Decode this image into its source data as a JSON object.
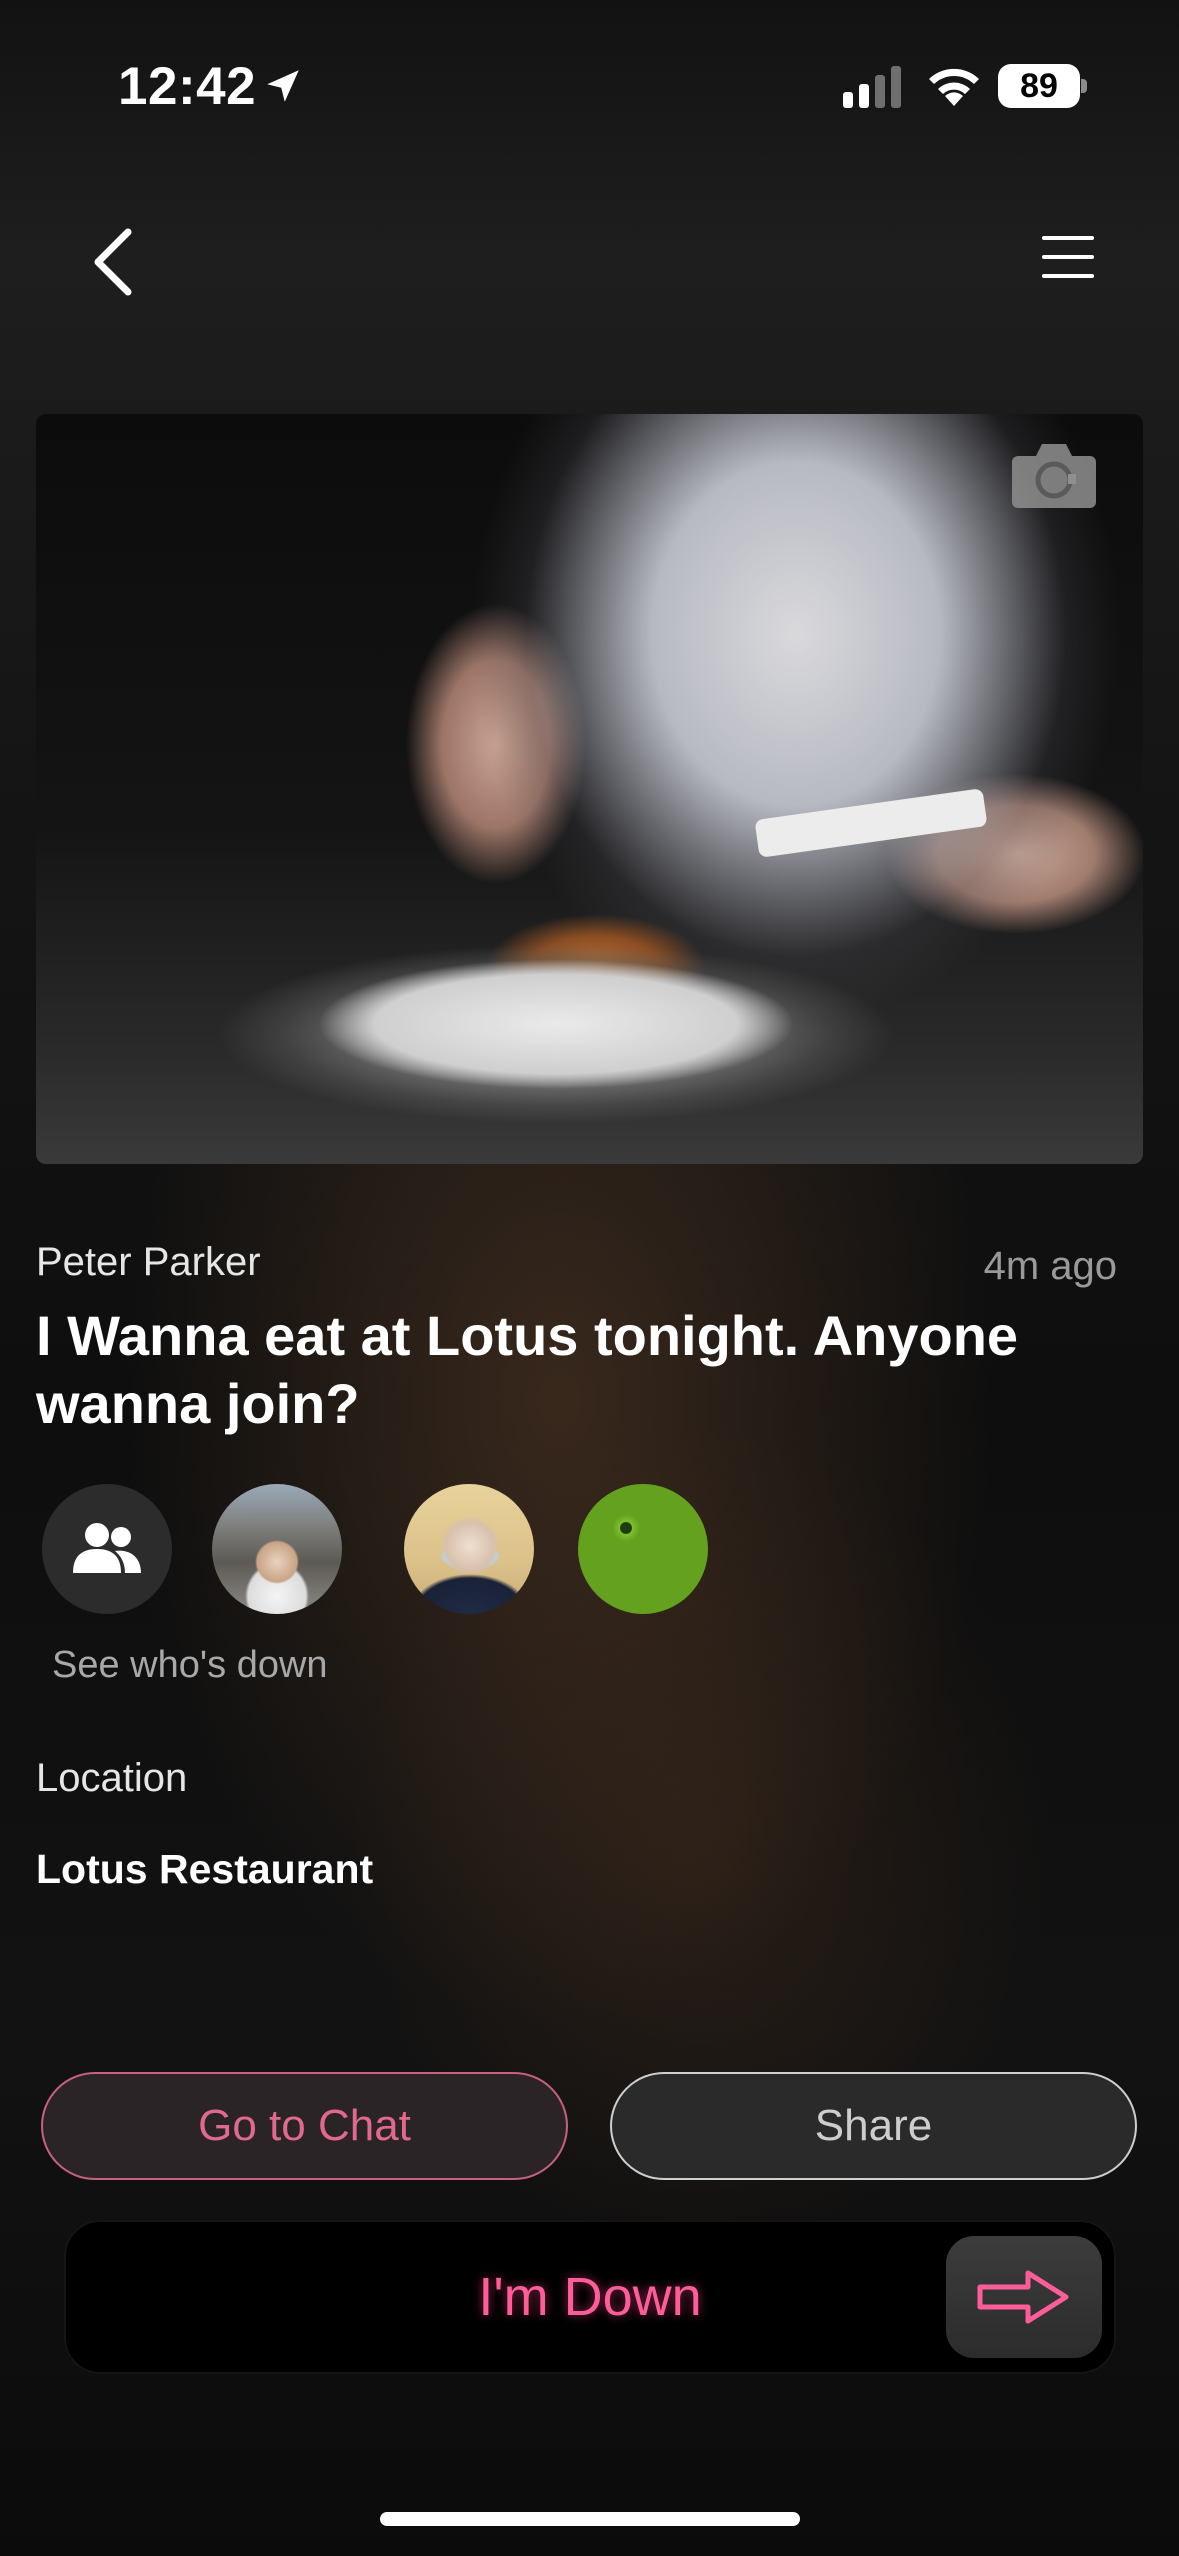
{
  "status_bar": {
    "time": "12:42",
    "battery": "89",
    "icons": [
      "location-arrow-icon",
      "cellular-signal-icon",
      "wifi-icon",
      "battery-icon"
    ]
  },
  "nav": {
    "icons": [
      "chevron-left-icon",
      "hamburger-menu-icon"
    ]
  },
  "post": {
    "image_icon": "camera-icon",
    "author": "Peter Parker",
    "posted_ago": "4m ago",
    "title": "I Wanna eat at Lotus tonight. Anyone wanna join?",
    "attendees": {
      "group_icon": "people-group-icon",
      "count_shown": 3,
      "see_label": "See who's down"
    },
    "location_label": "Location",
    "location_value": "Lotus Restaurant"
  },
  "actions": {
    "chat_label": "Go to Chat",
    "share_label": "Share",
    "down_label": "I'm Down",
    "down_icon": "arrow-right-icon"
  },
  "colors": {
    "accent_pink": "#ff5c9a",
    "chat_border": "#c8607e",
    "background": "#121212"
  }
}
